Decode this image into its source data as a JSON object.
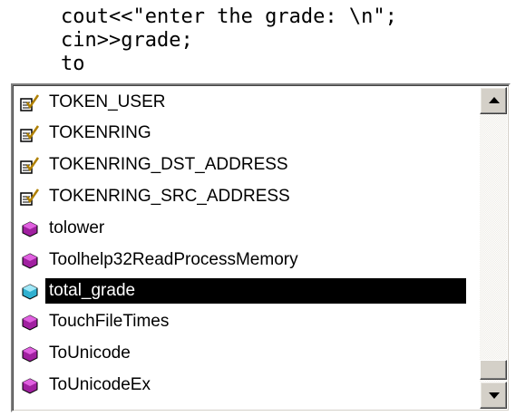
{
  "editor": {
    "lines": [
      "cout<<\"enter the grade: \\n\";",
      "cin>>grade;",
      "to"
    ]
  },
  "autocomplete": {
    "items": [
      {
        "label": "TOKEN_USER",
        "icon": "struct-icon",
        "selected": false
      },
      {
        "label": "TOKENRING",
        "icon": "struct-icon",
        "selected": false
      },
      {
        "label": "TOKENRING_DST_ADDRESS",
        "icon": "struct-icon",
        "selected": false
      },
      {
        "label": "TOKENRING_SRC_ADDRESS",
        "icon": "struct-icon",
        "selected": false
      },
      {
        "label": "tolower",
        "icon": "function-icon",
        "selected": false
      },
      {
        "label": "Toolhelp32ReadProcessMemory",
        "icon": "function-icon",
        "selected": false
      },
      {
        "label": "total_grade",
        "icon": "variable-icon",
        "selected": true
      },
      {
        "label": "TouchFileTimes",
        "icon": "function-icon",
        "selected": false
      },
      {
        "label": "ToUnicode",
        "icon": "function-icon",
        "selected": false
      },
      {
        "label": "ToUnicodeEx",
        "icon": "function-icon",
        "selected": false
      }
    ],
    "scroll_position": 0.9
  },
  "colors": {
    "selection_bg": "#000000",
    "selection_fg": "#ffffff",
    "function_icon": "#a020a0",
    "variable_icon": "#30b0d0",
    "struct_icon_check": "#b08000"
  }
}
